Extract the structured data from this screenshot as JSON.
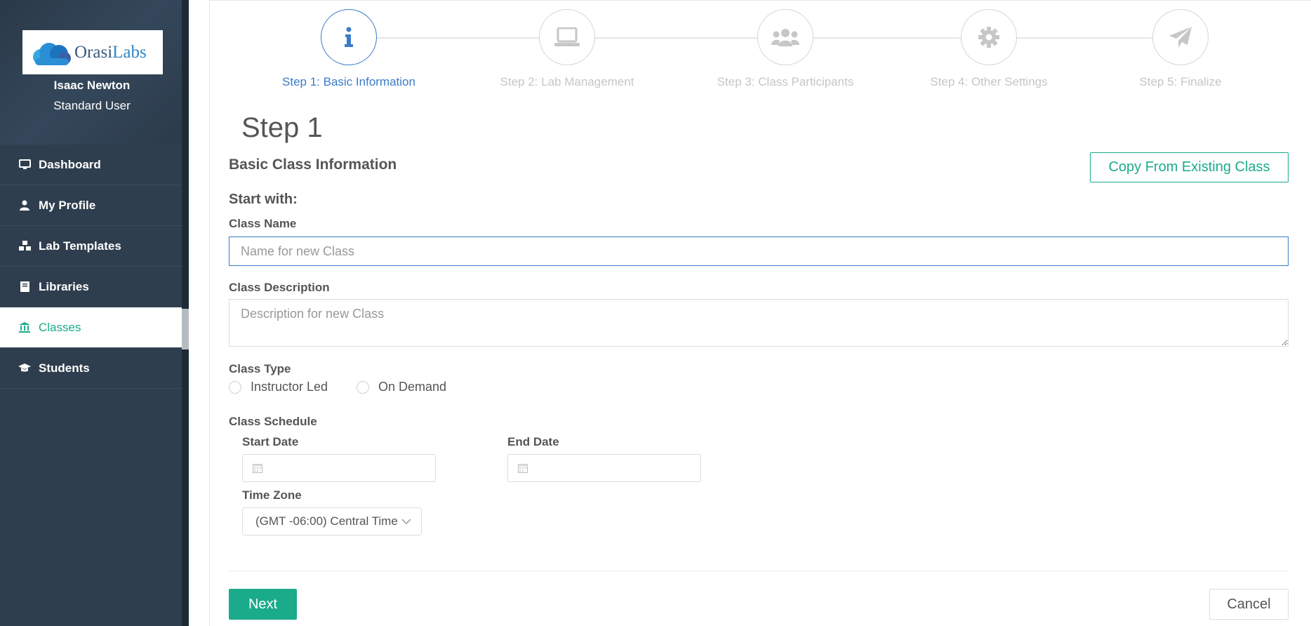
{
  "sidebar": {
    "logo": {
      "text_main": "Orasi",
      "text_accent": "Labs"
    },
    "user_name": "Isaac Newton",
    "user_role": "Standard User",
    "items": [
      {
        "label": "Dashboard",
        "icon": "monitor-icon"
      },
      {
        "label": "My Profile",
        "icon": "user-icon"
      },
      {
        "label": "Lab Templates",
        "icon": "cubes-icon"
      },
      {
        "label": "Libraries",
        "icon": "book-icon"
      },
      {
        "label": "Classes",
        "icon": "bank-icon",
        "active": true
      },
      {
        "label": "Students",
        "icon": "graduation-cap-icon"
      }
    ]
  },
  "steps": [
    {
      "label": "Step 1: Basic Information",
      "icon": "info-icon",
      "active": true
    },
    {
      "label": "Step 2: Lab Management",
      "icon": "laptop-icon"
    },
    {
      "label": "Step 3: Class Participants",
      "icon": "users-icon"
    },
    {
      "label": "Step 4: Other Settings",
      "icon": "gear-icon"
    },
    {
      "label": "Step 5: Finalize",
      "icon": "paper-plane-icon"
    }
  ],
  "form": {
    "step_title": "Step 1",
    "section_title": "Basic Class Information",
    "copy_button": "Copy From Existing Class",
    "start_with": "Start with:",
    "class_name_label": "Class Name",
    "class_name_placeholder": "Name for new Class",
    "class_name_value": "",
    "class_description_label": "Class Description",
    "class_description_placeholder": "Description for new Class",
    "class_type_label": "Class Type",
    "class_type_options": [
      "Instructor Led",
      "On Demand"
    ],
    "class_schedule_label": "Class Schedule",
    "start_date_label": "Start Date",
    "end_date_label": "End Date",
    "time_zone_label": "Time Zone",
    "time_zone_value": "(GMT -06:00) Central Time"
  },
  "footer": {
    "next": "Next",
    "cancel": "Cancel"
  },
  "colors": {
    "sidebar_bg": "#2f3e4e",
    "accent_green": "#1aab8b",
    "accent_blue": "#3b7bc8"
  }
}
